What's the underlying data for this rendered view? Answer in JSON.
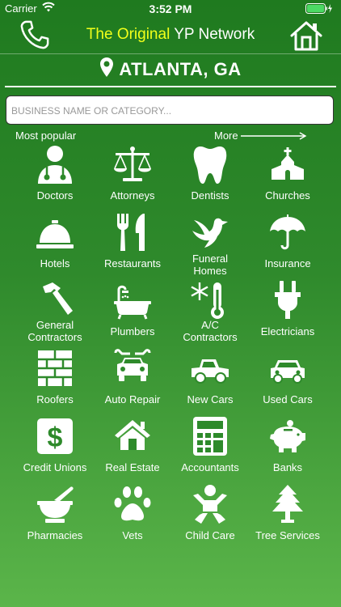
{
  "status_bar": {
    "carrier": "Carrier",
    "time": "3:52 PM"
  },
  "header": {
    "title_highlight": "The Original",
    "title_rest": " YP Network"
  },
  "location": {
    "text": "ATLANTA, GA"
  },
  "search": {
    "placeholder": "BUSINESS NAME OR CATEGORY..."
  },
  "sections": {
    "popular": "Most popular",
    "more": "More"
  },
  "categories": [
    {
      "label": "Doctors",
      "icon": "doctor-icon"
    },
    {
      "label": "Attorneys",
      "icon": "scales-icon"
    },
    {
      "label": "Dentists",
      "icon": "tooth-icon"
    },
    {
      "label": "Churches",
      "icon": "church-icon"
    },
    {
      "label": "Hotels",
      "icon": "bell-icon"
    },
    {
      "label": "Restaurants",
      "icon": "utensils-icon"
    },
    {
      "label": "Funeral\nHomes",
      "icon": "dove-icon"
    },
    {
      "label": "Insurance",
      "icon": "umbrella-icon"
    },
    {
      "label": "General\nContractors",
      "icon": "hammer-icon"
    },
    {
      "label": "Plumbers",
      "icon": "bathtub-icon"
    },
    {
      "label": "A/C\nContractors",
      "icon": "thermometer-icon"
    },
    {
      "label": "Electricians",
      "icon": "plug-icon"
    },
    {
      "label": "Roofers",
      "icon": "bricks-icon"
    },
    {
      "label": "Auto Repair",
      "icon": "car-wrench-icon"
    },
    {
      "label": "New Cars",
      "icon": "truck-icon"
    },
    {
      "label": "Used Cars",
      "icon": "car-icon"
    },
    {
      "label": "Credit Unions",
      "icon": "dollar-icon"
    },
    {
      "label": "Real Estate",
      "icon": "house-icon"
    },
    {
      "label": "Accountants",
      "icon": "calculator-icon"
    },
    {
      "label": "Banks",
      "icon": "piggy-bank-icon"
    },
    {
      "label": "Pharmacies",
      "icon": "mortar-pestle-icon"
    },
    {
      "label": "Vets",
      "icon": "paw-icon"
    },
    {
      "label": "Child Care",
      "icon": "baby-icon"
    },
    {
      "label": "Tree Services",
      "icon": "tree-icon"
    }
  ]
}
